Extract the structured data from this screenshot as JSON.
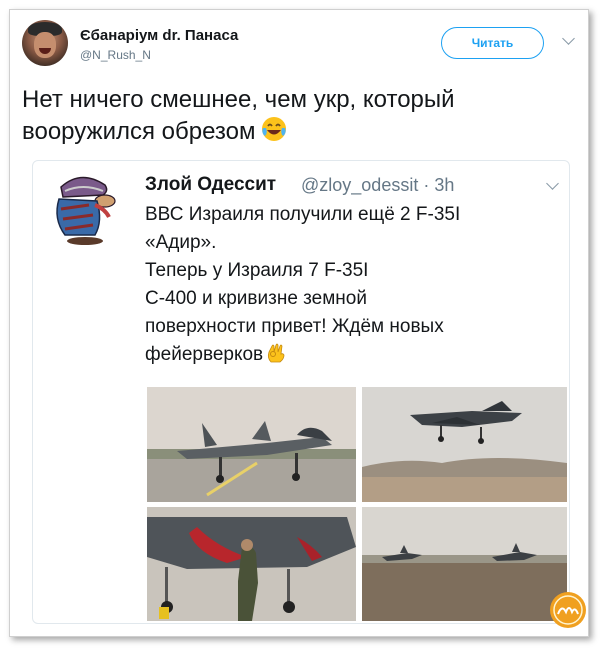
{
  "tweet": {
    "author_name": "Єбанаріум dr. Панаса",
    "author_handle": "@N_Rush_N",
    "follow_button": "Читать",
    "text": "Нет ничего смешнее, чем укр, который вооружился обрезом",
    "emoji": "tears-of-joy-emoji"
  },
  "quoted": {
    "author_name": "Злой Одессит",
    "handle_time": "@zloy_odessit · 3h",
    "lines": [
      "ВВС Израиля получили ещё 2 F-35I",
      "«Адир».",
      "Теперь у Израиля 7  F-35I",
      "С-400 и кривизне земной",
      "поверхности привет! Ждём новых",
      "фейерверков"
    ],
    "emoji": "ok-hand-emoji",
    "photos": [
      "f35-on-runway-photo",
      "f35-landing-photo",
      "f35-maintenance-photo",
      "f35-pair-taxiing-photo"
    ]
  },
  "watermark": {
    "icon": "site-logo-badge"
  },
  "colors": {
    "accent": "#1da1f2",
    "text": "#14171a",
    "muted": "#657786",
    "border": "#e1e8ed"
  }
}
